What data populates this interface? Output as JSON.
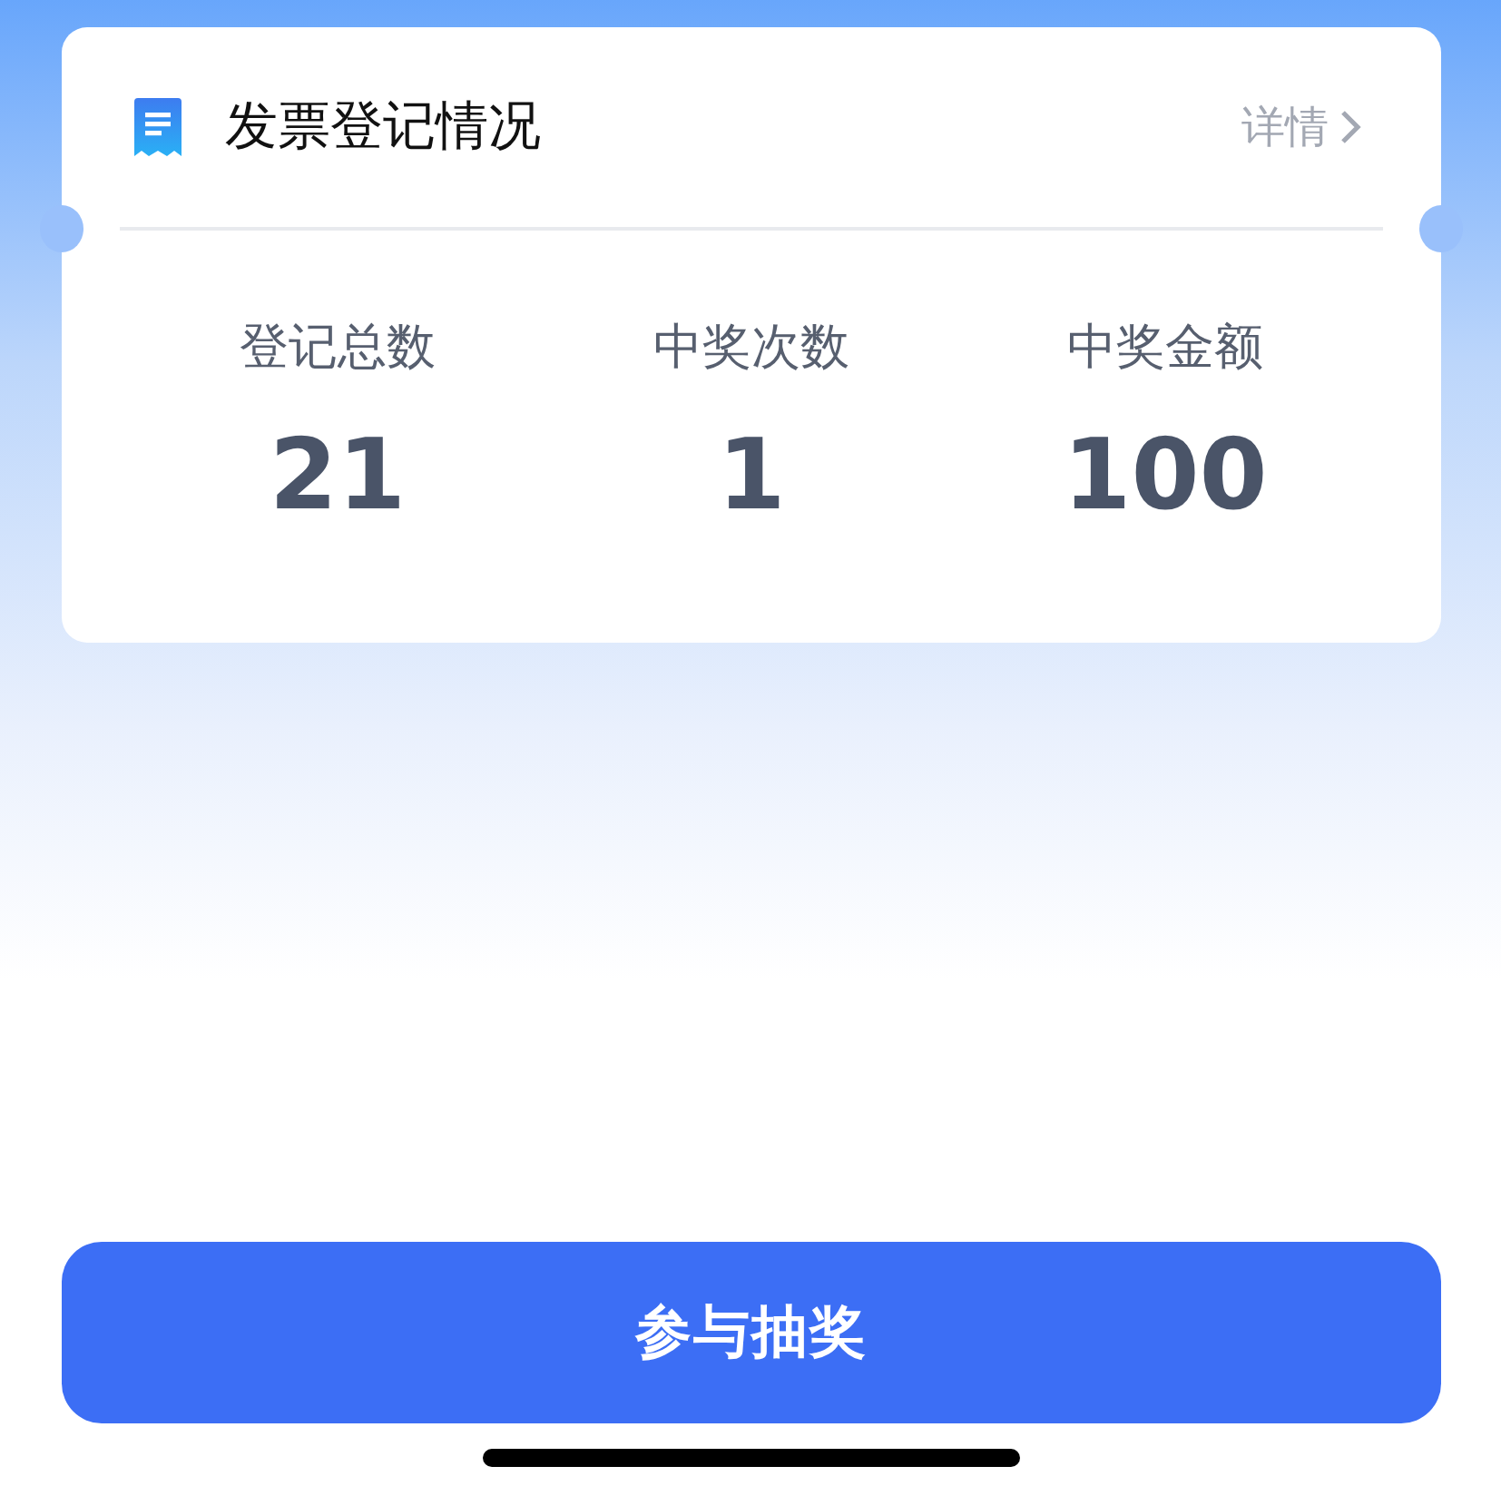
{
  "card": {
    "title": "发票登记情况",
    "details_link": "详情",
    "stats": [
      {
        "label": "登记总数",
        "value": "21"
      },
      {
        "label": "中奖次数",
        "value": "1"
      },
      {
        "label": "中奖金额",
        "value": "100"
      }
    ]
  },
  "action_button": "参与抽奖"
}
